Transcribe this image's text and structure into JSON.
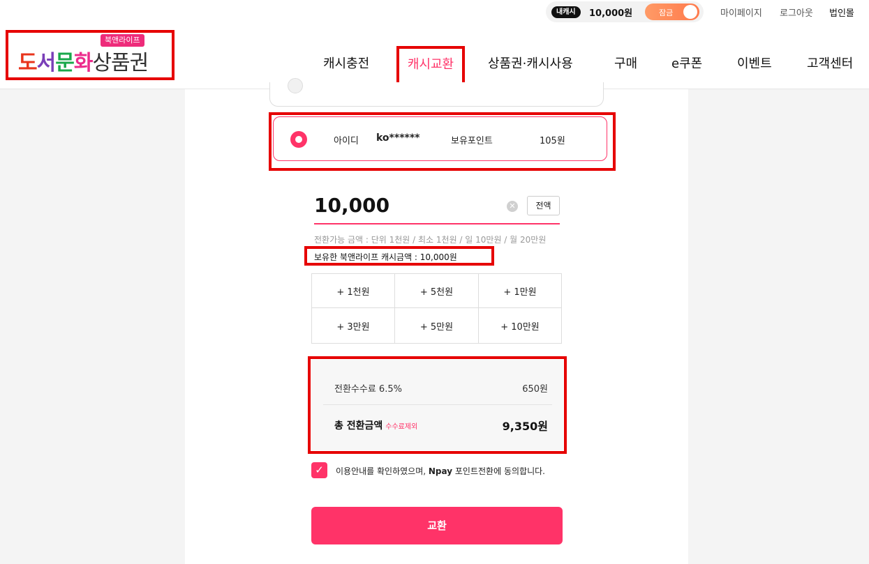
{
  "topbar": {
    "cash_badge": "내캐시",
    "cash_amount": "10,000원",
    "lock_label": "잠금",
    "mypage": "마이페이지",
    "logout": "로그아웃",
    "corporate": "법인몰"
  },
  "logo": {
    "tag": "북앤라이프",
    "part1": "도",
    "part2": "서",
    "part3": "문",
    "part4": "화",
    "part5": "상품권"
  },
  "nav": {
    "items": [
      "캐시충전",
      "캐시교환",
      "상품권·캐시사용",
      "구매",
      "e쿠폰",
      "이벤트",
      "고객센터"
    ],
    "active_index": 1
  },
  "account": {
    "id_label": "아이디",
    "id_value": "ko******",
    "points_label": "보유포인트",
    "points_value": "105원"
  },
  "amount": {
    "value": "10,000",
    "clear_symbol": "✕",
    "all_button": "전액",
    "limit_note": "전환가능 금액 : 단위 1천원 / 최소 1천원 / 일 10만원 / 월 20만원",
    "owned_note": "보유한 북앤라이프 캐시금액 : 10,000원"
  },
  "quick_add": [
    "+ 1천원",
    "+ 5천원",
    "+ 1만원",
    "+ 3만원",
    "+ 5만원",
    "+ 10만원"
  ],
  "fee": {
    "label": "전환수수료 6.5%",
    "value": "650원",
    "total_label": "총 전환금액",
    "total_sub": "수수료제외",
    "total_value": "9,350원"
  },
  "agree": {
    "checked": true,
    "text_before": "이용안내를 확인하였으며, ",
    "text_bold": "Npay",
    "text_after": " 포인트전환에 동의합니다."
  },
  "submit_label": "교환",
  "colors": {
    "accent": "#ff3368",
    "highlight": "#e60000",
    "toggle": "#ff8a5c"
  }
}
